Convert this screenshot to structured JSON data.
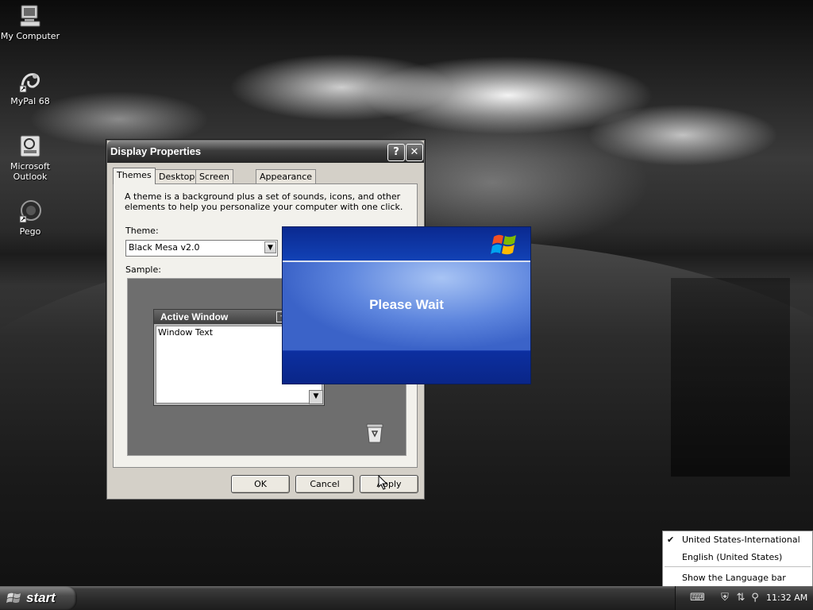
{
  "desktop": {
    "icons": [
      {
        "label": "My Computer",
        "icon": "my-computer-icon"
      },
      {
        "label": "MyPal 68",
        "icon": "mypal-icon"
      },
      {
        "label": "Microsoft Outlook",
        "icon": "outlook-icon"
      },
      {
        "label": "Pego",
        "icon": "pego-icon"
      }
    ]
  },
  "display_properties": {
    "title": "Display Properties",
    "help_button": "?",
    "close_button": "✕",
    "tabs": [
      {
        "label": "Themes",
        "active": true
      },
      {
        "label": "Desktop"
      },
      {
        "label": "Screen Saver"
      },
      {
        "label": "Appearance"
      }
    ],
    "description": "A theme is a background plus a set of sounds, icons, and other elements to help you personalize your computer with one click.",
    "theme_label": "Theme:",
    "theme_value": "Black Mesa v2.0",
    "sample_label": "Sample:",
    "sample_window": {
      "title": "Active Window",
      "text": "Window Text"
    },
    "buttons": {
      "ok": "OK",
      "cancel": "Cancel",
      "apply": "Apply"
    }
  },
  "please_wait": {
    "message": "Please Wait"
  },
  "language_menu": {
    "items": [
      {
        "label": "United States-International",
        "checked": true
      },
      {
        "label": "English (United States)",
        "checked": false
      }
    ],
    "show_language_bar": "Show the Language bar"
  },
  "taskbar": {
    "start_label": "start",
    "clock": "11:32 AM",
    "tray_icons": [
      "keyboard-icon",
      "security-shield-icon",
      "network-icon",
      "search-icon"
    ]
  }
}
